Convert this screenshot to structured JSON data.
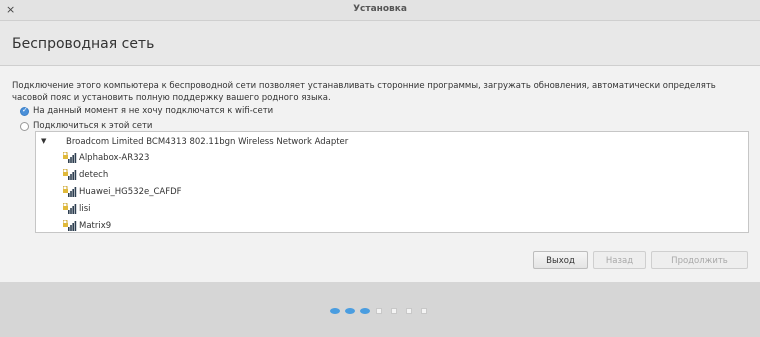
{
  "window": {
    "title": "Установка",
    "close_symbol": "×"
  },
  "header": {
    "page_title": "Беспроводная сеть"
  },
  "description": "Подключение этого компьютера к беспроводной сети позволяет устанавливать сторонние программы, загружать обновления, автоматически определять часовой пояс и установить полную поддержку вашего родного языка.",
  "options": [
    {
      "label": "На данный момент я не хочу подключатся к wifi-сети",
      "selected": true
    },
    {
      "label": "Подключиться к этой сети",
      "selected": false
    }
  ],
  "network_list": {
    "adapter": "Broadcom Limited BCM4313 802.11bgn Wireless Network Adapter",
    "networks": [
      "Alphabox-AR323",
      "detech",
      "Huawei_HG532e_CAFDF",
      "lisi",
      "Matrix9"
    ]
  },
  "buttons": {
    "quit": "Выход",
    "back": "Назад",
    "continue": "Продолжить"
  },
  "progress": {
    "total_steps": 7,
    "completed_steps": 3
  },
  "colors": {
    "accent": "#4a90d9",
    "progress_active": "#4a9de0"
  }
}
